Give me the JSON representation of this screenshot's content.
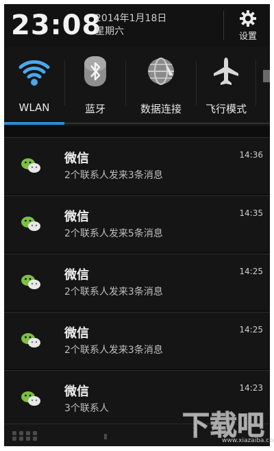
{
  "status_header": {
    "time": "23:08",
    "date": "2014年1月18日",
    "weekday": "星期六",
    "settings_label": "设置"
  },
  "quick_toggles": [
    {
      "label": "WLAN",
      "icon": "wifi-icon",
      "active": true
    },
    {
      "label": "蓝牙",
      "icon": "bluetooth-icon",
      "active": false
    },
    {
      "label": "数据连接",
      "icon": "globe-icon",
      "active": false
    },
    {
      "label": "飞行模式",
      "icon": "airplane-icon",
      "active": false
    }
  ],
  "notifications": [
    {
      "app": "微信",
      "message": "2个联系人发来3条消息",
      "time": "14:36"
    },
    {
      "app": "微信",
      "message": "2个联系人发来5条消息",
      "time": "14:35"
    },
    {
      "app": "微信",
      "message": "2个联系人发来3条消息",
      "time": "14:25"
    },
    {
      "app": "微信",
      "message": "2个联系人发来3条消息",
      "time": "14:25"
    },
    {
      "app": "微信",
      "message": "3个联系人",
      "time": "14:23"
    }
  ],
  "colors": {
    "accent": "#2a8fd6",
    "wechat_green": "#7bc142",
    "background": "#0d0d0d"
  },
  "watermark": {
    "text": "下载吧",
    "url": "www.xiazaiba.com"
  }
}
